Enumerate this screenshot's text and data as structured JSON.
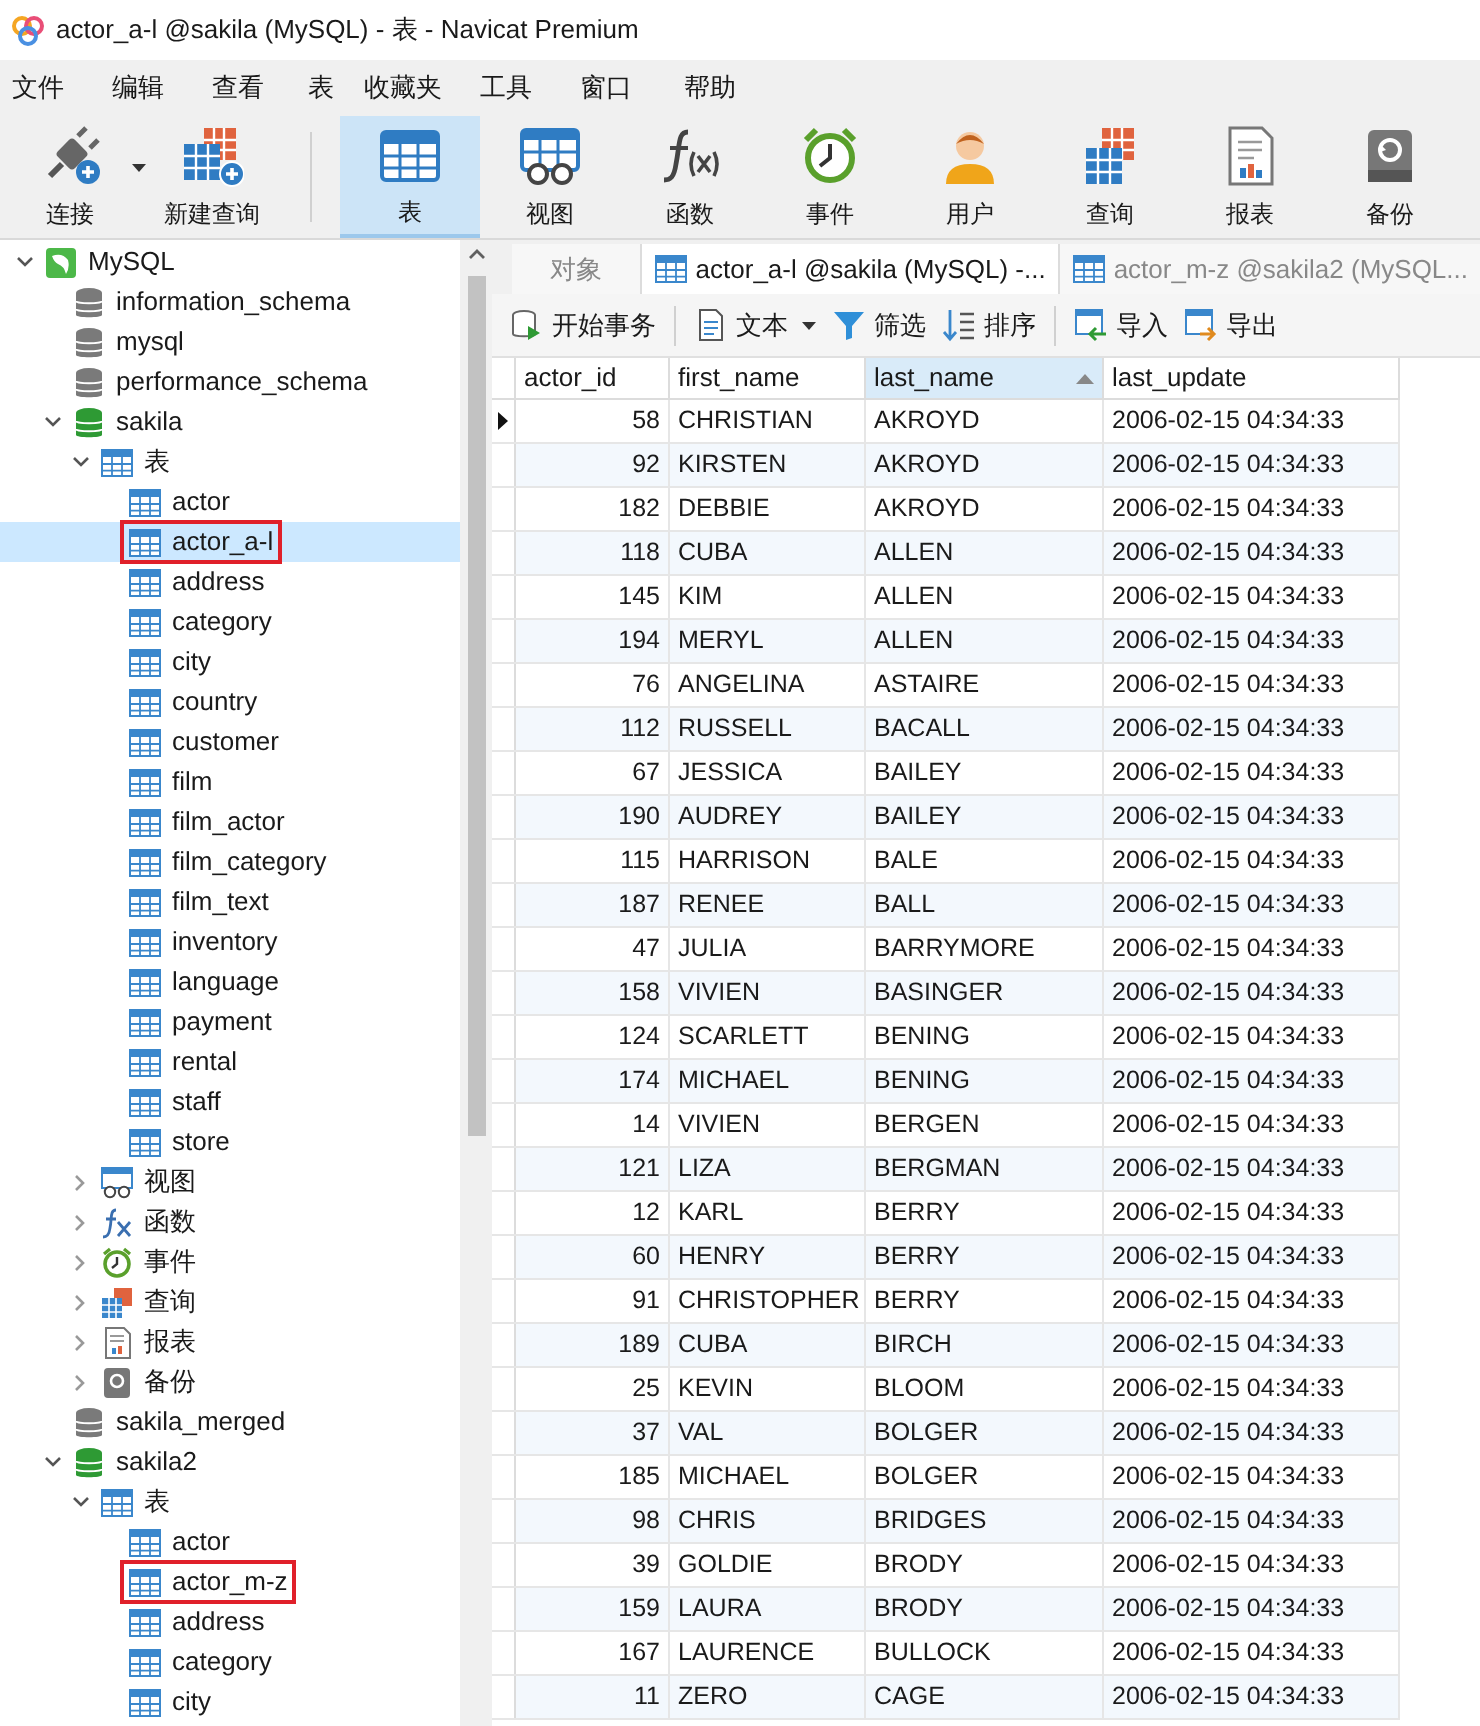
{
  "window": {
    "title": "actor_a-l @sakila (MySQL) - 表 - Navicat Premium"
  },
  "menu": [
    "文件",
    "编辑",
    "查看",
    "表",
    "收藏夹",
    "工具",
    "窗口",
    "帮助"
  ],
  "toolbar": [
    {
      "kind": "connect",
      "label": "连接",
      "selected": false,
      "dropdown": true
    },
    {
      "kind": "new-query",
      "label": "新建查询",
      "selected": false,
      "dropdown": false
    },
    {
      "kind": "table",
      "label": "表",
      "selected": true,
      "dropdown": false
    },
    {
      "kind": "view",
      "label": "视图",
      "selected": false,
      "dropdown": false
    },
    {
      "kind": "function",
      "label": "函数",
      "selected": false,
      "dropdown": false
    },
    {
      "kind": "event",
      "label": "事件",
      "selected": false,
      "dropdown": false
    },
    {
      "kind": "user",
      "label": "用户",
      "selected": false,
      "dropdown": false
    },
    {
      "kind": "query",
      "label": "查询",
      "selected": false,
      "dropdown": false
    },
    {
      "kind": "report",
      "label": "报表",
      "selected": false,
      "dropdown": false
    },
    {
      "kind": "backup",
      "label": "备份",
      "selected": false,
      "dropdown": false
    }
  ],
  "tree": [
    {
      "kind": "connection",
      "label": "MySQL",
      "expanded": true,
      "selected": false,
      "children": [
        {
          "kind": "database",
          "label": "information_schema",
          "expanded": false,
          "selected": false
        },
        {
          "kind": "database",
          "label": "mysql",
          "expanded": false,
          "selected": false
        },
        {
          "kind": "database",
          "label": "performance_schema",
          "expanded": false,
          "selected": false
        },
        {
          "kind": "database",
          "label": "sakila",
          "expanded": true,
          "selected": false,
          "children": [
            {
              "kind": "tables",
              "label": "表",
              "expanded": true,
              "selected": false,
              "children": [
                {
                  "kind": "table",
                  "label": "actor",
                  "selected": false,
                  "outlined": false
                },
                {
                  "kind": "table",
                  "label": "actor_a-l",
                  "selected": true,
                  "outlined": true
                },
                {
                  "kind": "table",
                  "label": "address",
                  "selected": false,
                  "outlined": false
                },
                {
                  "kind": "table",
                  "label": "category",
                  "selected": false,
                  "outlined": false
                },
                {
                  "kind": "table",
                  "label": "city",
                  "selected": false,
                  "outlined": false
                },
                {
                  "kind": "table",
                  "label": "country",
                  "selected": false,
                  "outlined": false
                },
                {
                  "kind": "table",
                  "label": "customer",
                  "selected": false,
                  "outlined": false
                },
                {
                  "kind": "table",
                  "label": "film",
                  "selected": false,
                  "outlined": false
                },
                {
                  "kind": "table",
                  "label": "film_actor",
                  "selected": false,
                  "outlined": false
                },
                {
                  "kind": "table",
                  "label": "film_category",
                  "selected": false,
                  "outlined": false
                },
                {
                  "kind": "table",
                  "label": "film_text",
                  "selected": false,
                  "outlined": false
                },
                {
                  "kind": "table",
                  "label": "inventory",
                  "selected": false,
                  "outlined": false
                },
                {
                  "kind": "table",
                  "label": "language",
                  "selected": false,
                  "outlined": false
                },
                {
                  "kind": "table",
                  "label": "payment",
                  "selected": false,
                  "outlined": false
                },
                {
                  "kind": "table",
                  "label": "rental",
                  "selected": false,
                  "outlined": false
                },
                {
                  "kind": "table",
                  "label": "staff",
                  "selected": false,
                  "outlined": false
                },
                {
                  "kind": "table",
                  "label": "store",
                  "selected": false,
                  "outlined": false
                }
              ]
            },
            {
              "kind": "views",
              "label": "视图",
              "expanded": false,
              "selected": false
            },
            {
              "kind": "functions",
              "label": "函数",
              "expanded": false,
              "selected": false
            },
            {
              "kind": "events",
              "label": "事件",
              "expanded": false,
              "selected": false
            },
            {
              "kind": "queries",
              "label": "查询",
              "expanded": false,
              "selected": false
            },
            {
              "kind": "reports",
              "label": "报表",
              "expanded": false,
              "selected": false
            },
            {
              "kind": "backups",
              "label": "备份",
              "expanded": false,
              "selected": false
            }
          ]
        },
        {
          "kind": "database",
          "label": "sakila_merged",
          "expanded": false,
          "selected": false
        },
        {
          "kind": "database",
          "label": "sakila2",
          "expanded": true,
          "selected": false,
          "children": [
            {
              "kind": "tables",
              "label": "表",
              "expanded": true,
              "selected": false,
              "children": [
                {
                  "kind": "table",
                  "label": "actor",
                  "selected": false,
                  "outlined": false
                },
                {
                  "kind": "table",
                  "label": "actor_m-z",
                  "selected": false,
                  "outlined": true
                },
                {
                  "kind": "table",
                  "label": "address",
                  "selected": false,
                  "outlined": false
                },
                {
                  "kind": "table",
                  "label": "category",
                  "selected": false,
                  "outlined": false
                },
                {
                  "kind": "table",
                  "label": "city",
                  "selected": false,
                  "outlined": false
                }
              ]
            }
          ]
        }
      ]
    }
  ],
  "tabs": [
    {
      "kind": "objects",
      "label": "对象",
      "selected": false
    },
    {
      "kind": "table",
      "label": "actor_a-l @sakila (MySQL) -...",
      "selected": true
    },
    {
      "kind": "table",
      "label": "actor_m-z @sakila2 (MySQL...",
      "selected": false
    }
  ],
  "grid_toolbar": [
    {
      "kind": "transaction",
      "label": "开始事务",
      "dropdown": false
    },
    {
      "kind": "text",
      "label": "文本",
      "dropdown": true
    },
    {
      "kind": "filter",
      "label": "筛选",
      "dropdown": false
    },
    {
      "kind": "sort",
      "label": "排序",
      "dropdown": false
    },
    {
      "kind": "import",
      "label": "导入",
      "dropdown": false
    },
    {
      "kind": "export",
      "label": "导出",
      "dropdown": false
    }
  ],
  "table": {
    "columns": [
      {
        "label": "actor_id",
        "sorted": false
      },
      {
        "label": "first_name",
        "sorted": false
      },
      {
        "label": "last_name",
        "sorted": true
      },
      {
        "label": "last_update",
        "sorted": false
      }
    ],
    "rows": [
      {
        "current": true,
        "cells": [
          "58",
          "CHRISTIAN",
          "AKROYD",
          "2006-02-15 04:34:33"
        ]
      },
      {
        "current": false,
        "cells": [
          "92",
          "KIRSTEN",
          "AKROYD",
          "2006-02-15 04:34:33"
        ]
      },
      {
        "current": false,
        "cells": [
          "182",
          "DEBBIE",
          "AKROYD",
          "2006-02-15 04:34:33"
        ]
      },
      {
        "current": false,
        "cells": [
          "118",
          "CUBA",
          "ALLEN",
          "2006-02-15 04:34:33"
        ]
      },
      {
        "current": false,
        "cells": [
          "145",
          "KIM",
          "ALLEN",
          "2006-02-15 04:34:33"
        ]
      },
      {
        "current": false,
        "cells": [
          "194",
          "MERYL",
          "ALLEN",
          "2006-02-15 04:34:33"
        ]
      },
      {
        "current": false,
        "cells": [
          "76",
          "ANGELINA",
          "ASTAIRE",
          "2006-02-15 04:34:33"
        ]
      },
      {
        "current": false,
        "cells": [
          "112",
          "RUSSELL",
          "BACALL",
          "2006-02-15 04:34:33"
        ]
      },
      {
        "current": false,
        "cells": [
          "67",
          "JESSICA",
          "BAILEY",
          "2006-02-15 04:34:33"
        ]
      },
      {
        "current": false,
        "cells": [
          "190",
          "AUDREY",
          "BAILEY",
          "2006-02-15 04:34:33"
        ]
      },
      {
        "current": false,
        "cells": [
          "115",
          "HARRISON",
          "BALE",
          "2006-02-15 04:34:33"
        ]
      },
      {
        "current": false,
        "cells": [
          "187",
          "RENEE",
          "BALL",
          "2006-02-15 04:34:33"
        ]
      },
      {
        "current": false,
        "cells": [
          "47",
          "JULIA",
          "BARRYMORE",
          "2006-02-15 04:34:33"
        ]
      },
      {
        "current": false,
        "cells": [
          "158",
          "VIVIEN",
          "BASINGER",
          "2006-02-15 04:34:33"
        ]
      },
      {
        "current": false,
        "cells": [
          "124",
          "SCARLETT",
          "BENING",
          "2006-02-15 04:34:33"
        ]
      },
      {
        "current": false,
        "cells": [
          "174",
          "MICHAEL",
          "BENING",
          "2006-02-15 04:34:33"
        ]
      },
      {
        "current": false,
        "cells": [
          "14",
          "VIVIEN",
          "BERGEN",
          "2006-02-15 04:34:33"
        ]
      },
      {
        "current": false,
        "cells": [
          "121",
          "LIZA",
          "BERGMAN",
          "2006-02-15 04:34:33"
        ]
      },
      {
        "current": false,
        "cells": [
          "12",
          "KARL",
          "BERRY",
          "2006-02-15 04:34:33"
        ]
      },
      {
        "current": false,
        "cells": [
          "60",
          "HENRY",
          "BERRY",
          "2006-02-15 04:34:33"
        ]
      },
      {
        "current": false,
        "cells": [
          "91",
          "CHRISTOPHER",
          "BERRY",
          "2006-02-15 04:34:33"
        ]
      },
      {
        "current": false,
        "cells": [
          "189",
          "CUBA",
          "BIRCH",
          "2006-02-15 04:34:33"
        ]
      },
      {
        "current": false,
        "cells": [
          "25",
          "KEVIN",
          "BLOOM",
          "2006-02-15 04:34:33"
        ]
      },
      {
        "current": false,
        "cells": [
          "37",
          "VAL",
          "BOLGER",
          "2006-02-15 04:34:33"
        ]
      },
      {
        "current": false,
        "cells": [
          "185",
          "MICHAEL",
          "BOLGER",
          "2006-02-15 04:34:33"
        ]
      },
      {
        "current": false,
        "cells": [
          "98",
          "CHRIS",
          "BRIDGES",
          "2006-02-15 04:34:33"
        ]
      },
      {
        "current": false,
        "cells": [
          "39",
          "GOLDIE",
          "BRODY",
          "2006-02-15 04:34:33"
        ]
      },
      {
        "current": false,
        "cells": [
          "159",
          "LAURA",
          "BRODY",
          "2006-02-15 04:34:33"
        ]
      },
      {
        "current": false,
        "cells": [
          "167",
          "LAURENCE",
          "BULLOCK",
          "2006-02-15 04:34:33"
        ]
      },
      {
        "current": false,
        "cells": [
          "11",
          "ZERO",
          "CAGE",
          "2006-02-15 04:34:33"
        ]
      }
    ]
  }
}
